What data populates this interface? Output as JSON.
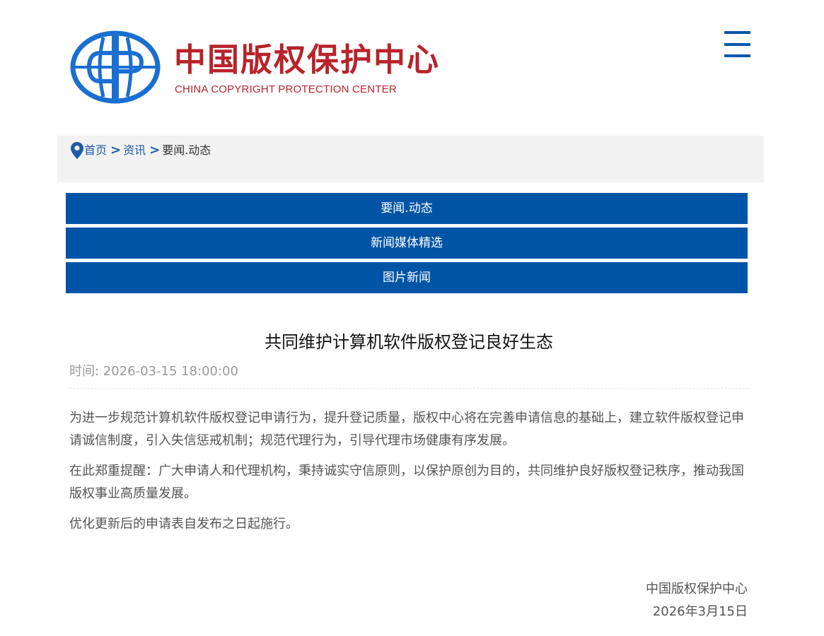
{
  "header": {
    "logo_cn": "中国版权保护中心",
    "logo_en": "CHINA COPYRIGHT PROTECTION CENTER",
    "brand_color": "#b8232a",
    "emblem_color": "#1a6fd1",
    "menu_icon": "hamburger-menu-icon"
  },
  "breadcrumb": {
    "icon": "location-pin-icon",
    "items": [
      "首页",
      "资讯"
    ],
    "separator": ">",
    "current": "要闻.动态"
  },
  "nav": {
    "color": "#0054a6",
    "items": [
      "要闻.动态",
      "新闻媒体精选",
      "图片新闻"
    ]
  },
  "article": {
    "title": "共同维护计算机软件版权登记良好生态",
    "meta": "时间: 2026-03-15 18:00:00",
    "paragraphs": [
      "为进一步规范计算机软件版权登记申请行为，提升登记质量，版权中心将在完善申请信息的基础上，建立软件版权登记申请诚信制度，引入失信惩戒机制；规范代理行为，引导代理市场健康有序发展。",
      "在此郑重提醒：广大申请人和代理机构，秉持诚实守信原则，以保护原创为目的，共同维护良好版权登记秩序，推动我国版权事业高质量发展。",
      "优化更新后的申请表自发布之日起施行。"
    ],
    "signoff_org": "中国版权保护中心",
    "signoff_date": "2026年3月15日"
  }
}
